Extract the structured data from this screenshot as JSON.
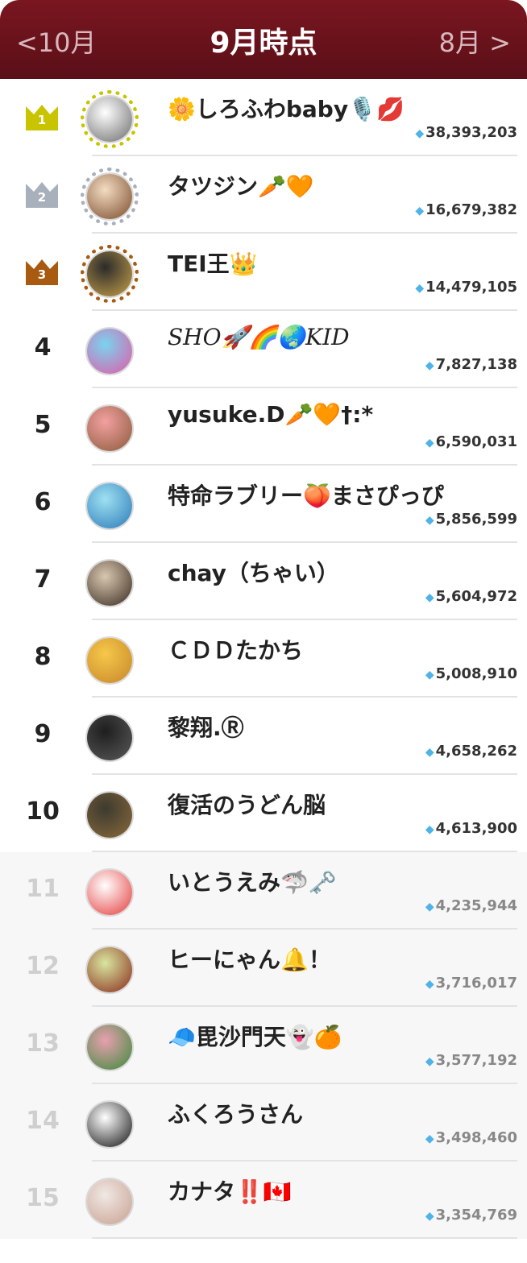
{
  "header": {
    "prev_label": "<10月",
    "title": "9月時点",
    "next_label": "8月 >"
  },
  "ranking": [
    {
      "rank": "1",
      "name": "🌼しろふわbaby🎙️💋",
      "score": "38,393,203",
      "crown": "gold",
      "crown_color": "#c9c400",
      "avatar_colors": [
        "#ffffff",
        "#6b6b6b"
      ]
    },
    {
      "rank": "2",
      "name": "タツジン🥕🧡",
      "score": "16,679,382",
      "crown": "silver",
      "crown_color": "#a8b0bc",
      "avatar_colors": [
        "#f3dcc2",
        "#7a4a2a"
      ]
    },
    {
      "rank": "3",
      "name": "TEI王👑",
      "score": "14,479,105",
      "crown": "bronze",
      "crown_color": "#a85a10",
      "avatar_colors": [
        "#2b2b2b",
        "#c9a24a"
      ]
    },
    {
      "rank": "4",
      "name": "SHO🚀🌈🌏KID",
      "score": "7,827,138",
      "avatar_colors": [
        "#7ad3ef",
        "#e25aa8"
      ]
    },
    {
      "rank": "5",
      "name": "yusuke.D🥕🧡†:*",
      "score": "6,590,031",
      "avatar_colors": [
        "#f3a0a0",
        "#8a5a3a"
      ]
    },
    {
      "rank": "6",
      "name": "特命ラブリー🍑まさぴっぴ",
      "score": "5,856,599",
      "avatar_colors": [
        "#9fe0f2",
        "#2a7ab8"
      ]
    },
    {
      "rank": "7",
      "name": "chay（ちゃい）",
      "score": "5,604,972",
      "avatar_colors": [
        "#d8c8b0",
        "#3a2a20"
      ]
    },
    {
      "rank": "8",
      "name": "ＣＤＤたかち",
      "score": "5,008,910",
      "avatar_colors": [
        "#f5c84a",
        "#c8862a"
      ]
    },
    {
      "rank": "9",
      "name": "黎翔.Ⓡ",
      "score": "4,658,262",
      "avatar_colors": [
        "#1e1e1e",
        "#5a5a5a"
      ]
    },
    {
      "rank": "10",
      "name": "復活のうどん脳",
      "score": "4,613,900",
      "avatar_colors": [
        "#3c3a30",
        "#8a6a3a"
      ]
    },
    {
      "rank": "11",
      "name": "いとうえみ🦈🗝️",
      "score": "4,235,944",
      "avatar_colors": [
        "#ffffff",
        "#e53a3a"
      ]
    },
    {
      "rank": "12",
      "name": "ヒーにゃん🔔！",
      "score": "3,716,017",
      "avatar_colors": [
        "#d8e6a0",
        "#8a2a1a"
      ]
    },
    {
      "rank": "13",
      "name": "🧢毘沙門天👻🍊",
      "score": "3,577,192",
      "avatar_colors": [
        "#e8a0b0",
        "#3a8a3a"
      ]
    },
    {
      "rank": "14",
      "name": "ふくろうさん",
      "score": "3,498,460",
      "avatar_colors": [
        "#ffffff",
        "#111111"
      ]
    },
    {
      "rank": "15",
      "name": "カナタ‼️🇨🇦",
      "score": "3,354,769",
      "avatar_colors": [
        "#f0e8e4",
        "#c8a090"
      ]
    }
  ],
  "gem_icon": "diamond-icon",
  "accent_color": "#6a121c"
}
